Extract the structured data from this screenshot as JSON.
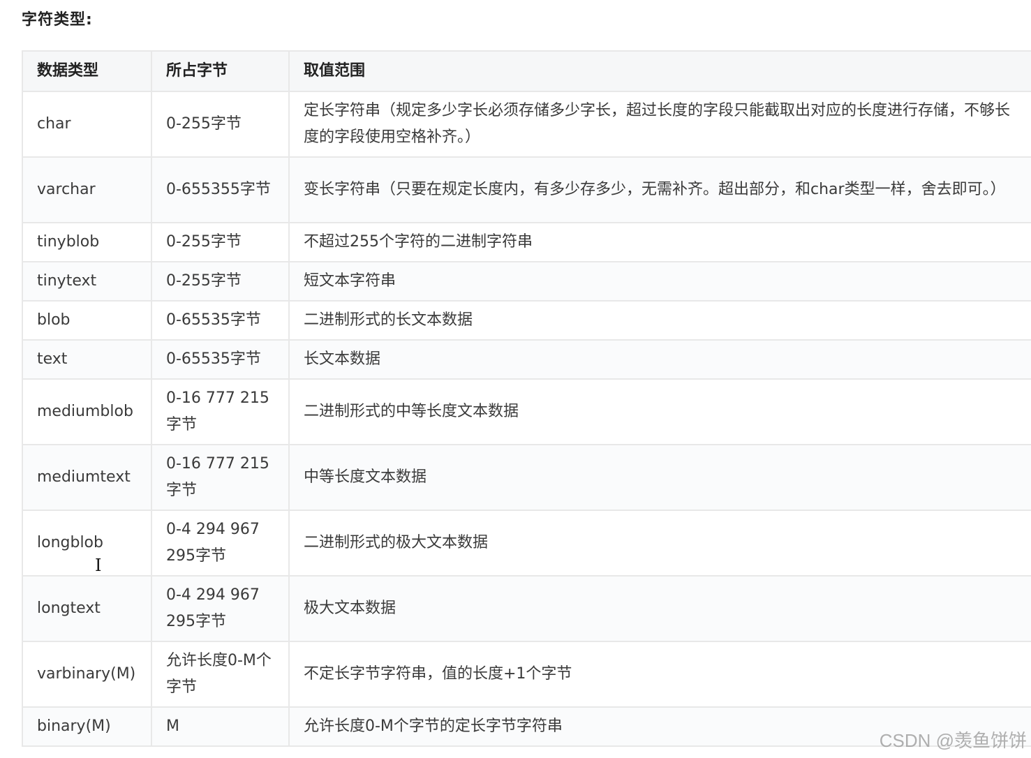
{
  "heading": "字符类型:",
  "columns": [
    "数据类型",
    "所占字节",
    "取值范围"
  ],
  "rows": [
    {
      "type": "char",
      "bytes": "0-255字节",
      "range": "定长字符串（规定多少字长必须存储多少字长，超过长度的字段只能截取出对应的长度进行存储，不够长度的字段使用空格补齐。）"
    },
    {
      "type": "varchar",
      "bytes": "0-655355字节",
      "range": "变长字符串（只要在规定长度内，有多少存多少，无需补齐。超出部分，和char类型一样，舍去即可。）"
    },
    {
      "type": "tinyblob",
      "bytes": "0-255字节",
      "range": "不超过255个字符的二进制字符串"
    },
    {
      "type": "tinytext",
      "bytes": "0-255字节",
      "range": "短文本字符串"
    },
    {
      "type": "blob",
      "bytes": "0-65535字节",
      "range": "二进制形式的长文本数据"
    },
    {
      "type": "text",
      "bytes": "0-65535字节",
      "range": "长文本数据"
    },
    {
      "type": "mediumblob",
      "bytes": "0-16 777 215字节",
      "range": "二进制形式的中等长度文本数据"
    },
    {
      "type": "mediumtext",
      "bytes": "0-16 777 215字节",
      "range": "中等长度文本数据"
    },
    {
      "type": "longblob",
      "bytes": "0-4 294 967 295字节",
      "range": "二进制形式的极大文本数据"
    },
    {
      "type": "longtext",
      "bytes": "0-4 294 967 295字节",
      "range": "极大文本数据"
    },
    {
      "type": "varbinary(M)",
      "bytes": "允许长度0-M个字节",
      "range": "不定长字节字符串，值的长度+1个字节"
    },
    {
      "type": "binary(M)",
      "bytes": "M",
      "range": "允许长度0-M个字节的定长字节字符串"
    }
  ],
  "watermark": "CSDN @羡鱼饼饼",
  "icons": {
    "cursor": "text-cursor-icon"
  }
}
